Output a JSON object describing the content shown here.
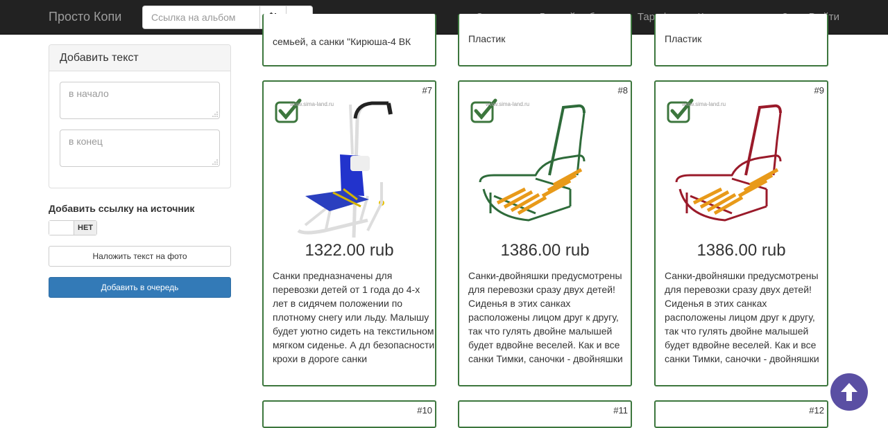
{
  "navbar": {
    "brand": "Просто Копи",
    "search_placeholder": "Ссылка на альбом",
    "links": [
      "Задания",
      "Личный кабинет",
      "Тарифы",
      "Как пользоваться?",
      "Выйти"
    ]
  },
  "sidebar": {
    "panel_title": "Добавить текст",
    "start_placeholder": "в начало",
    "end_placeholder": "в конец",
    "source_label": "Добавить ссылку на источник",
    "toggle_value": "НЕТ",
    "overlay_button": "Наложить текст на фото",
    "queue_button": "Добавить в очередь"
  },
  "top_row": [
    {
      "text": "семьей, а санки \"Кирюша-4 ВК"
    },
    {
      "text": "Пластик"
    },
    {
      "text": "Пластик"
    }
  ],
  "cards": [
    {
      "num": "#7",
      "price": "1322.00 rub",
      "watermark": "www.sima-land.ru",
      "desc": "Санки предназначены для перевозки детей от 1 года до 4-х лет в сидячем положении по плотному снегу или льду. Малышу будет уютно сидеть на текстильном мягком сиденье. А дл безопасности крохи в дороге санки"
    },
    {
      "num": "#8",
      "price": "1386.00 rub",
      "watermark": "www.sima-land.ru",
      "desc": "Санки-двойняшки предусмотрены для перевозки сразу двух детей! Сиденья в этих санках расположены лицом друг к другу, так что гулять двойне малышей будет вдвойне веселей. Как и все санки Тимки, саночки - двойняшки"
    },
    {
      "num": "#9",
      "price": "1386.00 rub",
      "watermark": "www.sima-land.ru",
      "desc": "Санки-двойняшки предусмотрены для перевозки сразу двух детей! Сиденья в этих санках расположены лицом друг к другу, так что гулять двойне малышей будет вдвойне веселей. Как и все санки Тимки, саночки - двойняшки"
    }
  ],
  "bottom_row": [
    {
      "num": "#10"
    },
    {
      "num": "#11"
    },
    {
      "num": "#12"
    }
  ],
  "colors": {
    "card_border": "#3c763d",
    "primary": "#337ab7",
    "scroll_button": "#5a4fa3",
    "navbar": "#222222"
  }
}
